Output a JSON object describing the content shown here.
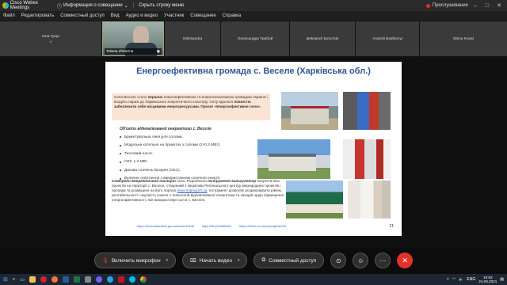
{
  "titlebar": {
    "app_name": "Cisco Webex Meetings",
    "center_left": "Информация о совещании",
    "center_right": "Скрыть строку меню",
    "recording": "Прослушивание"
  },
  "menu": [
    "Файл",
    "Редактировать",
    "Совместный доступ",
    "Вид",
    "Аудио и видео",
    "Участник",
    "Совещание",
    "Справка"
  ],
  "participants": [
    {
      "name": "Інна Гуща",
      "sub": "ø",
      "video": false
    },
    {
      "name": "Tetiana Zheleznа",
      "video": true
    },
    {
      "name": "Oleksandra",
      "video": false
    },
    {
      "name": "Олександра Трибой",
      "video": false
    },
    {
      "name": "aleksandr kyrychok",
      "video": false
    },
    {
      "name": "Anatolii Bashtovyi",
      "video": false
    },
    {
      "name": "Elena Koval",
      "video": false
    }
  ],
  "slide": {
    "title": "Енергоефективна громада с. Веселе (Харківська обл.)",
    "intro_parts": [
      "Село Веселе стало ",
      "першою",
      " енергоефективною та енергонезалежною громадою України і входить наразі до Харківського енергетичного кластеру. Селу вдалося ",
      "повністю забезпечити себе місцевими енергоресурсами. Проєкт «Енергоефективне село»."
    ],
    "objects_title": "Об'єкти відновлюваної енергетики с. Веселе",
    "objects": [
      "Брикетувальна лінія для соломи.",
      "Модульна котельня на брикетах з соломи (2×0,4 МВт).",
      "Тепловий насос.",
      "СЕС 1,2 МВт.",
      "Дахова сонячна батарея (СЕС).",
      "Вуличне освітлення з використанням сонячної енергії."
    ],
    "passport_bold": "Створено Енергетичний паспорт",
    "passport_mid": " села. Розроблено ",
    "passport_bold2": "інструмент-калькулятор",
    "passport_rest1": " енергетичних проектів на території с. Веселе, створений з ініціативи Регіонального центру міжнародних проектів і програм та розміщено на його порталі ",
    "passport_link": "www.mtprog.kh.ua",
    "passport_rest2": ". Інструмент дозволяє розраховувати рівень рентабельності і окупність кожної з технологій відновлюваної енергетики та заходів щодо підвищення енергоефективності, яке використовується в с. Веселе.",
    "footer_links": [
      "https://decentralization.gov.ua/news/10438",
      "https://bit.ly/2uk8B641",
      "https://forum.cci.ua/ua/projects/118"
    ],
    "page_number": "21"
  },
  "controls": {
    "mute_label": "Включить микрофон",
    "video_label": "Начать видео",
    "share_label": "Совместный доступ"
  },
  "taskbar": {
    "lang": "ENG",
    "time": "10:53",
    "date": "24.09.2021"
  },
  "colors": {
    "slide_title": "#2f5597",
    "intro_bg": "#fbe4d5",
    "end_button": "#e0322b",
    "link": "#2d63c8"
  }
}
